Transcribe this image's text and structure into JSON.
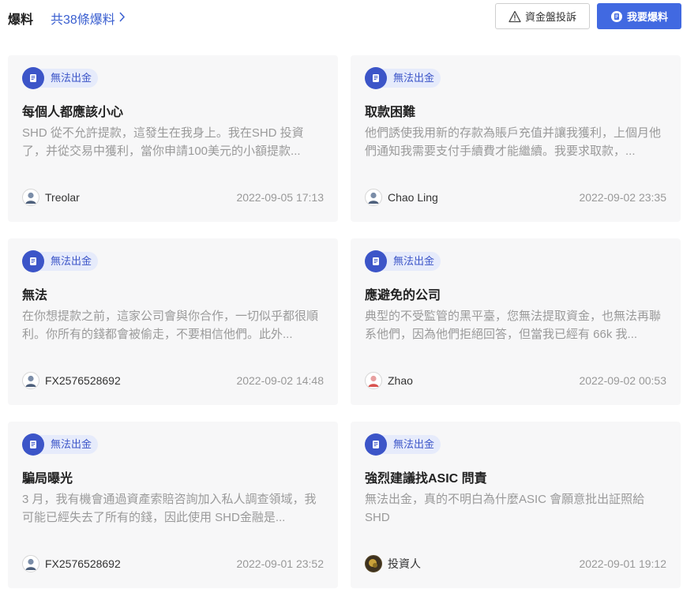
{
  "header": {
    "title": "爆料",
    "count_link": "共38條爆料",
    "complain_button": "資金盤投訴",
    "expose_button": "我要爆料"
  },
  "cards": [
    {
      "tag": "無法出金",
      "title": "每個人都應該小心",
      "body": "SHD 從不允許提款，這發生在我身上。我在SHD 投資了，并從交易中獲利，當你申請100美元的小額提款...",
      "author": "Treolar",
      "date": "2022-09-05 17:13",
      "avatar_icon": "default-user-avatar"
    },
    {
      "tag": "無法出金",
      "title": "取款困難",
      "body": "他們誘使我用新的存款為賬戶充值并讓我獲利，上個月他們通知我需要支付手續費才能繼續。我要求取款，...",
      "author": "Chao Ling",
      "date": "2022-09-02 23:35",
      "avatar_icon": "default-user-avatar"
    },
    {
      "tag": "無法出金",
      "title": "無法",
      "body": "在你想提款之前，這家公司會與你合作，一切似乎都很順利。你所有的錢都會被偷走，不要相信他們。此外...",
      "author": "FX2576528692",
      "date": "2022-09-02 14:48",
      "avatar_icon": "default-user-avatar"
    },
    {
      "tag": "無法出金",
      "title": "應避免的公司",
      "body": "典型的不受監管的黑平臺，您無法提取資金，也無法再聯系他們，因為他們拒絕回答，但當我已經有 66k 我...",
      "author": "Zhao",
      "date": "2022-09-02 00:53",
      "avatar_icon": "red-user-avatar"
    },
    {
      "tag": "無法出金",
      "title": "騙局曝光",
      "body": "3 月，我有機會通過資產索賠咨詢加入私人調查領域，我可能已經失去了所有的錢，因此使用 SHD金融是...",
      "author": "FX2576528692",
      "date": "2022-09-01 23:52",
      "avatar_icon": "default-user-avatar"
    },
    {
      "tag": "無法出金",
      "title": "強烈建議找ASIC 問責",
      "body": "無法出金，真的不明白為什麼ASIC 會願意批出証照給SHD",
      "author": "投資人",
      "date": "2022-09-01 19:12",
      "avatar_icon": "photo-avatar"
    }
  ],
  "colors": {
    "accent": "#4169e1",
    "tag_bg": "#e6ebfb",
    "tag_fg": "#3c55c8",
    "card_bg": "#f7f7f8"
  }
}
